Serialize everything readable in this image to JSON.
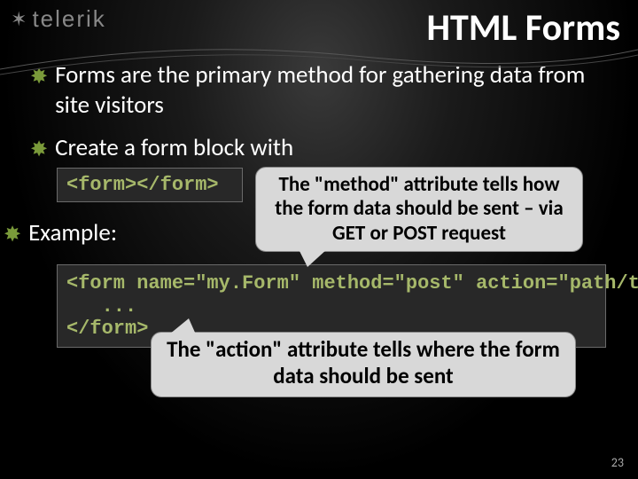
{
  "brand": "telerik",
  "title": "HTML Forms",
  "bullets": {
    "b1": "Forms are the primary method for gathering data from site visitors",
    "b2": "Create a form block with",
    "b3": "Example:"
  },
  "code1": "<form></form>",
  "callout1": "The \"method\" attribute tells how the form data should be sent – via GET or POST request",
  "code2": "<form name=\"my.Form\" method=\"post\" action=\"path/to/some-script.php\">\n   ...\n</form>",
  "callout2": "The \"action\" attribute tells where the form data should be sent",
  "page": "23"
}
